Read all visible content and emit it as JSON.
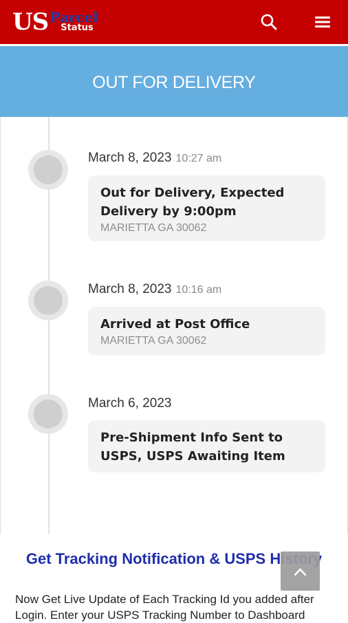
{
  "header": {
    "logo": {
      "us": "US",
      "parcel": "Parcel",
      "status": "Status"
    },
    "brand_color": "#c40000",
    "search_icon": "search-icon",
    "menu_icon": "hamburger-menu-icon"
  },
  "banner": {
    "title": "OUT FOR DELIVERY",
    "color": "#65aee0"
  },
  "events": [
    {
      "date": "March 8, 2023",
      "time": "10:27 am",
      "title": "Out for Delivery, Expected Delivery by 9:00pm",
      "location": "MARIETTA GA 30062"
    },
    {
      "date": "March 8, 2023",
      "time": "10:16 am",
      "title": "Arrived at Post Office",
      "location": "MARIETTA GA 30062"
    },
    {
      "date": "March 6, 2023",
      "time": "",
      "title": "Pre-Shipment Info Sent to USPS, USPS Awaiting Item",
      "location": ""
    }
  ],
  "promo": {
    "title": "Get Tracking Notification & USPS History",
    "text": "Now Get Live Update of Each Tracking Id you added after Login. Enter your USPS Tracking Number to Dashboard"
  },
  "scroll_top_icon": "chevron-up-icon"
}
